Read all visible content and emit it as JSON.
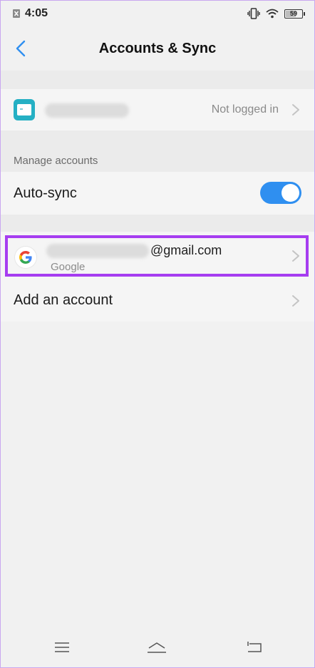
{
  "status_bar": {
    "time": "4:05",
    "battery_level": "59",
    "icons": [
      "notification-x-icon",
      "vibrate-icon",
      "wifi-icon",
      "battery-icon"
    ]
  },
  "header": {
    "title": "Accounts & Sync",
    "back_icon": "chevron-left-icon"
  },
  "account_card": {
    "status": "Not logged in"
  },
  "manage_accounts": {
    "section_label": "Manage accounts",
    "auto_sync_label": "Auto-sync",
    "auto_sync_enabled": true
  },
  "accounts": [
    {
      "email_suffix": "@gmail.com",
      "provider": "Google"
    }
  ],
  "add_account_label": "Add an account",
  "nav_bar": {
    "icons": [
      "menu-icon",
      "home-icon",
      "back-icon"
    ]
  },
  "colors": {
    "accent": "#2f8ff0",
    "highlight": "#a63df0",
    "app_icon": "#25b0c4"
  }
}
